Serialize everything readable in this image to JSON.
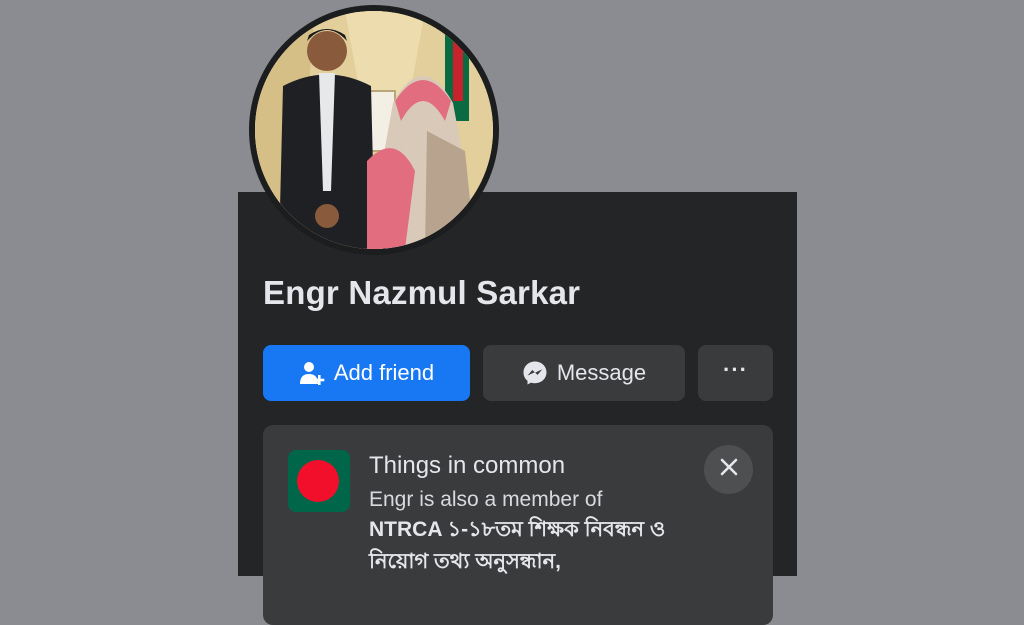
{
  "profile": {
    "name": "Engr Nazmul Sarkar"
  },
  "actions": {
    "add_friend_label": "Add friend",
    "message_label": "Message",
    "more_label": "···"
  },
  "things_in_common": {
    "title": "Things in common",
    "text": "Engr is also a member of",
    "group": "NTRCA ১-১৮তম শিক্ষক নিবন্ধন ও নিয়োগ তথ্য অনুসন্ধান,"
  },
  "icons": {
    "add_friend": "add-friend-icon",
    "message": "messenger-icon",
    "close": "close-icon",
    "group": "bangladesh-flag-icon"
  },
  "colors": {
    "background": "#8b8c91",
    "panel": "#242526",
    "primary_button": "#1877f2",
    "secondary_button": "#3a3b3c",
    "flag_green": "#00664a",
    "flag_red": "#f20f2c"
  }
}
